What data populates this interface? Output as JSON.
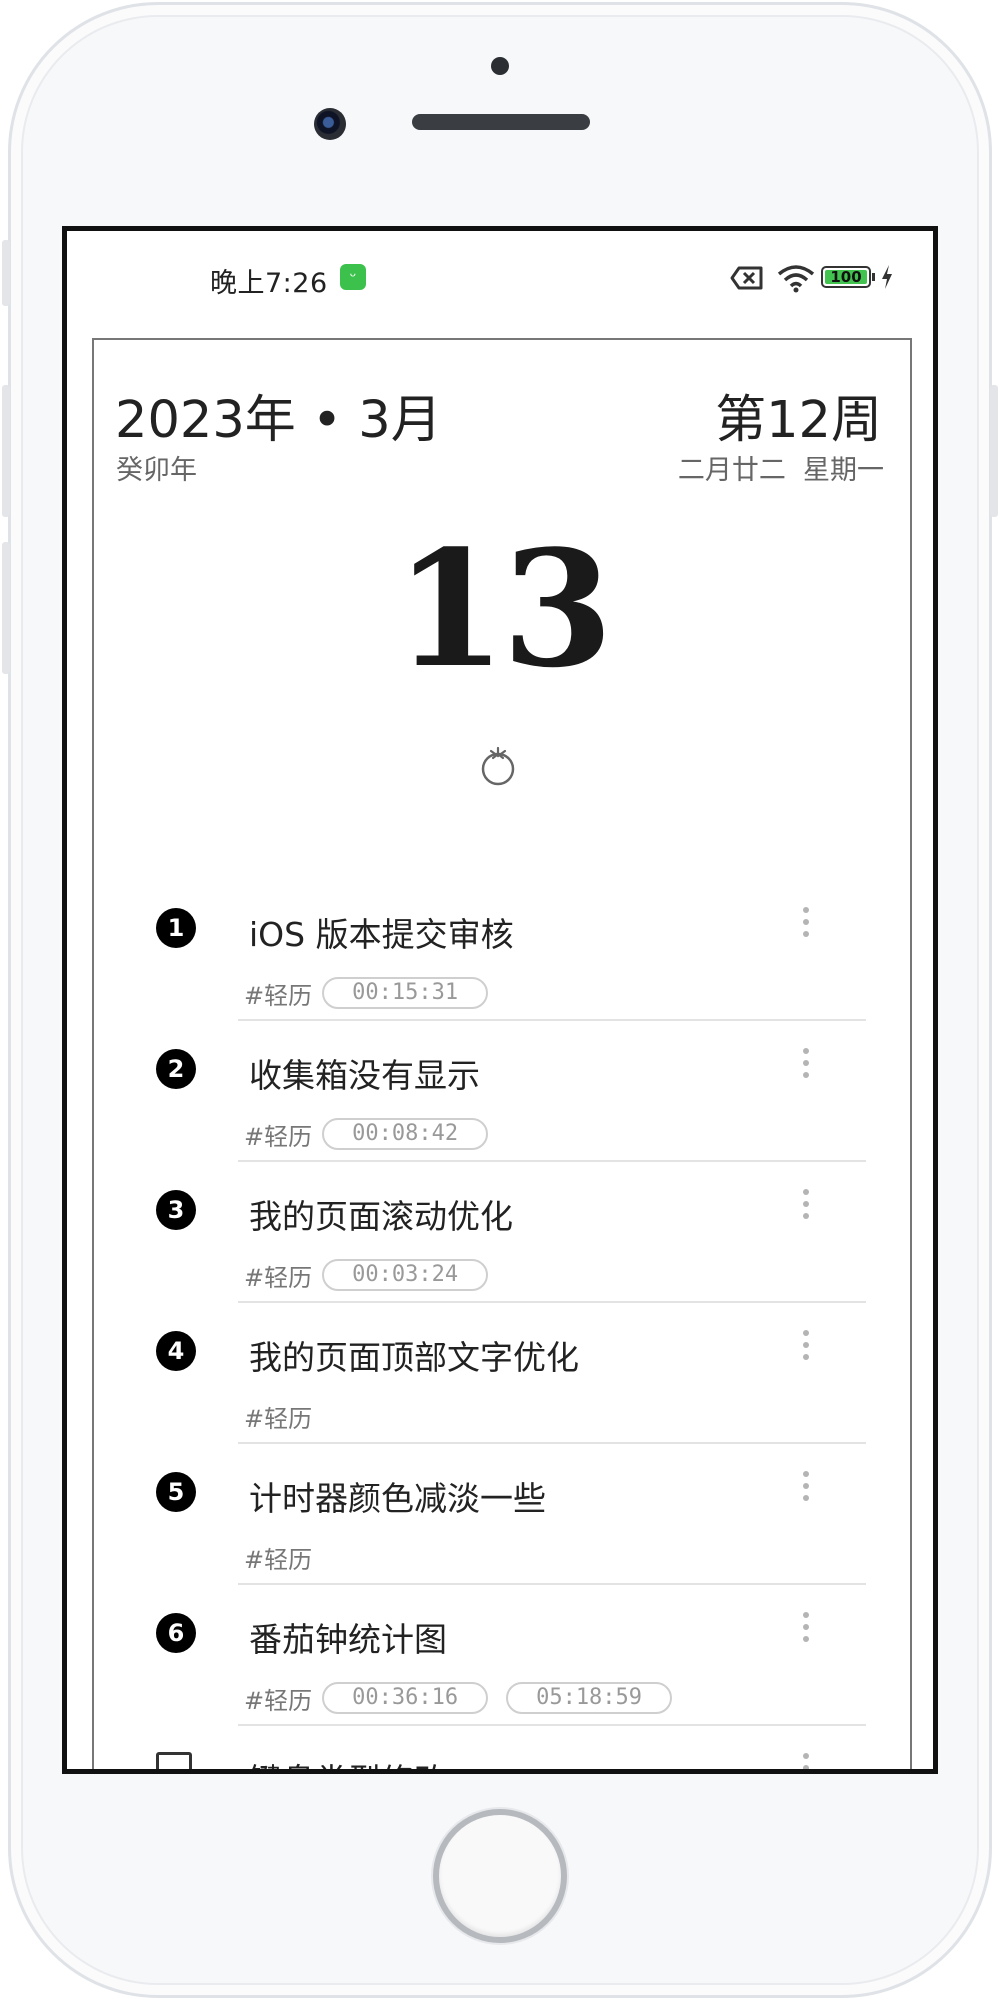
{
  "status_bar": {
    "time": "晚上7:26",
    "battery": "100"
  },
  "header": {
    "year_month": "2023年 • 3月",
    "ganzhi": "癸卯年",
    "week": "第12周",
    "lunar_date": "二月廿二",
    "weekday": "星期一"
  },
  "day": "13",
  "tasks": [
    {
      "index": "1",
      "title": "iOS 版本提交审核",
      "tag": "#轻历",
      "timers": [
        "00:15:31"
      ]
    },
    {
      "index": "2",
      "title": "收集箱没有显示",
      "tag": "#轻历",
      "timers": [
        "00:08:42"
      ]
    },
    {
      "index": "3",
      "title": "我的页面滚动优化",
      "tag": "#轻历",
      "timers": [
        "00:03:24"
      ]
    },
    {
      "index": "4",
      "title": "我的页面顶部文字优化",
      "tag": "#轻历",
      "timers": []
    },
    {
      "index": "5",
      "title": "计时器颜色减淡一些",
      "tag": "#轻历",
      "timers": []
    },
    {
      "index": "6",
      "title": "番茄钟统计图",
      "tag": "#轻历",
      "timers": [
        "00:36:16",
        "05:18:59"
      ]
    },
    {
      "index": "",
      "title": "键盘类型修改",
      "tag": "",
      "timers": []
    }
  ]
}
